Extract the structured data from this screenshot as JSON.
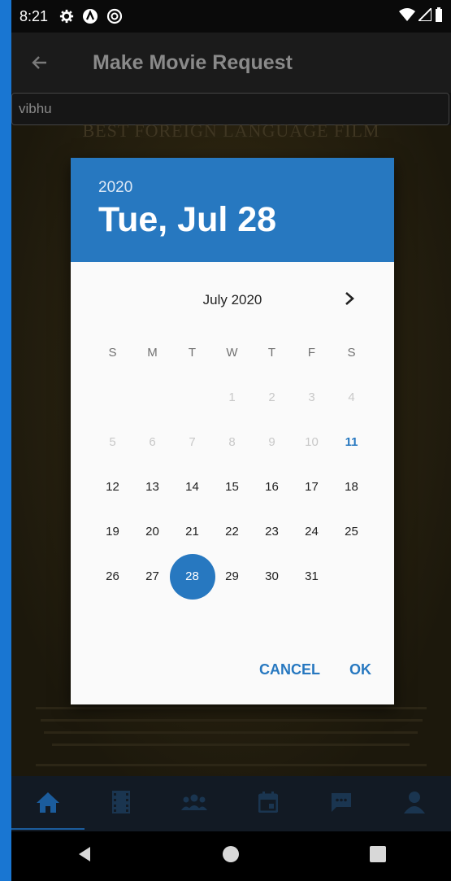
{
  "status_bar": {
    "time": "8:21",
    "icons": [
      "gear-icon",
      "a-circle-icon",
      "at-circle-icon"
    ],
    "right_icons": [
      "wifi-icon",
      "signal-icon",
      "battery-icon"
    ]
  },
  "app_bar": {
    "title": "Make Movie Request"
  },
  "search": {
    "value": "vibhu"
  },
  "poster": {
    "line1": "BEST FOREIGN LANGUAGE FILM"
  },
  "date_picker": {
    "year": "2020",
    "selected_date": "Tue, Jul 28",
    "month_label": "July 2020",
    "weekdays": [
      "S",
      "M",
      "T",
      "W",
      "T",
      "F",
      "S"
    ],
    "weeks": [
      [
        "",
        "",
        "",
        "1",
        "2",
        "3",
        "4"
      ],
      [
        "5",
        "6",
        "7",
        "8",
        "9",
        "10",
        "11"
      ],
      [
        "12",
        "13",
        "14",
        "15",
        "16",
        "17",
        "18"
      ],
      [
        "19",
        "20",
        "21",
        "22",
        "23",
        "24",
        "25"
      ],
      [
        "26",
        "27",
        "28",
        "29",
        "30",
        "31",
        ""
      ]
    ],
    "disabled_before": 11,
    "today": "11",
    "selected": "28",
    "cancel_label": "CANCEL",
    "ok_label": "OK",
    "accent_color": "#2778c0"
  },
  "bottom_nav": {
    "items": [
      "home-icon",
      "film-icon",
      "people-icon",
      "calendar-icon",
      "chat-icon",
      "person-icon"
    ],
    "active": "home-icon",
    "active_color": "#1b5c9c",
    "inactive_color": "#1a3550"
  }
}
